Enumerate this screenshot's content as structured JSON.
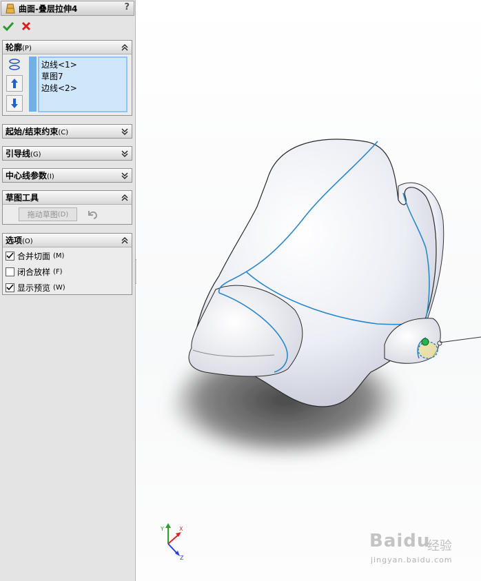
{
  "feature": {
    "title": "曲面-叠层拉伸4",
    "help": "?"
  },
  "actions": {
    "ok_icon": "check-icon",
    "cancel_icon": "close-icon"
  },
  "profile": {
    "header": "轮廓",
    "shortcut": "(P)",
    "items": [
      "边线<1>",
      "草图7",
      "边线<2>"
    ],
    "accent": "#6cb0ec"
  },
  "groups": {
    "start_end": {
      "label": "起始/结束约束",
      "shortcut": "(C)"
    },
    "guides": {
      "label": "引导线",
      "shortcut": "(G)"
    },
    "centerline": {
      "label": "中心线参数",
      "shortcut": "(I)"
    }
  },
  "sketch_tools": {
    "header": "草图工具",
    "drag_button": "拖动草图",
    "drag_shortcut": "(D)"
  },
  "options": {
    "header": "选项",
    "shortcut": "(O)",
    "items": [
      {
        "label": "合并切面",
        "shortcut": "(M)",
        "checked": true
      },
      {
        "label": "闭合放样",
        "shortcut": "(F)",
        "checked": false
      },
      {
        "label": "显示预览",
        "shortcut": "(W)",
        "checked": true
      }
    ]
  },
  "watermark": {
    "brand": "Baidu",
    "cn": "经验",
    "url": "jingyan.baidu.com"
  },
  "triad": {
    "x": "X",
    "y": "Y",
    "z": "Z"
  }
}
